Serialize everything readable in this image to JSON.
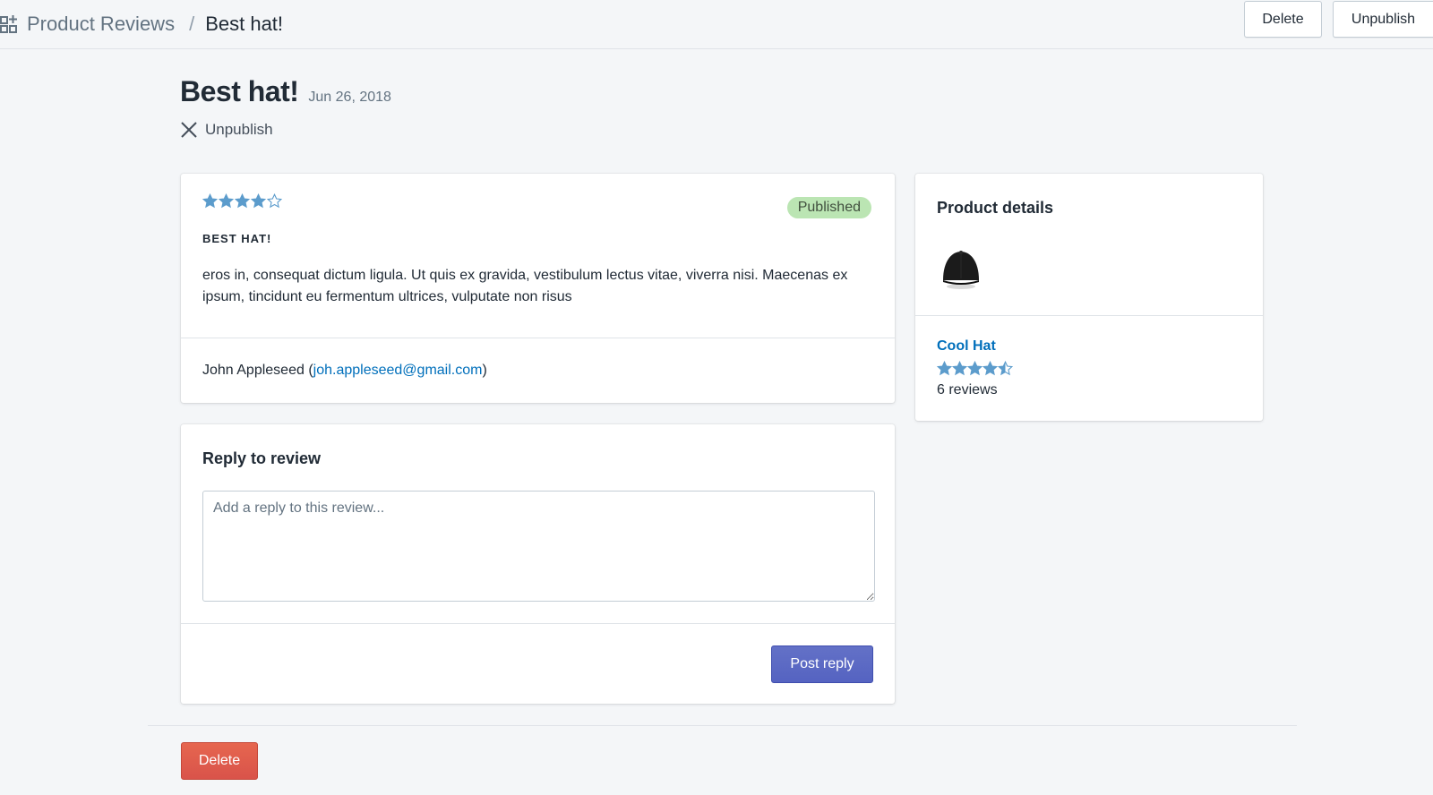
{
  "breadcrumb": {
    "root": "Product Reviews",
    "separator": "/",
    "current": "Best hat!"
  },
  "top_actions": {
    "delete_label": "Delete",
    "unpublish_label": "Unpublish"
  },
  "header": {
    "title": "Best hat!",
    "date": "Jun 26, 2018",
    "unpublish_label": "Unpublish"
  },
  "review": {
    "rating": 4,
    "max_rating": 5,
    "status": "Published",
    "title": "BEST HAT!",
    "body": "eros in, consequat dictum ligula. Ut quis ex gravida, vestibulum lectus vitae, viverra nisi. Maecenas ex ipsum, tincidunt eu fermentum ultrices, vulputate non risus",
    "author_name": "John Appleseed",
    "author_email": "joh.appleseed@gmail.com",
    "paren_open": "(",
    "paren_close": ")"
  },
  "reply": {
    "title": "Reply to review",
    "placeholder": "Add a reply to this review...",
    "post_label": "Post reply"
  },
  "product": {
    "section_title": "Product details",
    "name": "Cool Hat",
    "rating": 4.5,
    "reviews_text": "6 reviews",
    "image_icon": "hat-icon"
  },
  "footer": {
    "delete_label": "Delete"
  },
  "colors": {
    "star": "#5c9ccc",
    "link": "#006fbb",
    "badge_bg": "#bbe5b3",
    "primary": "#5c6ac4",
    "destructive": "#de5c48"
  }
}
